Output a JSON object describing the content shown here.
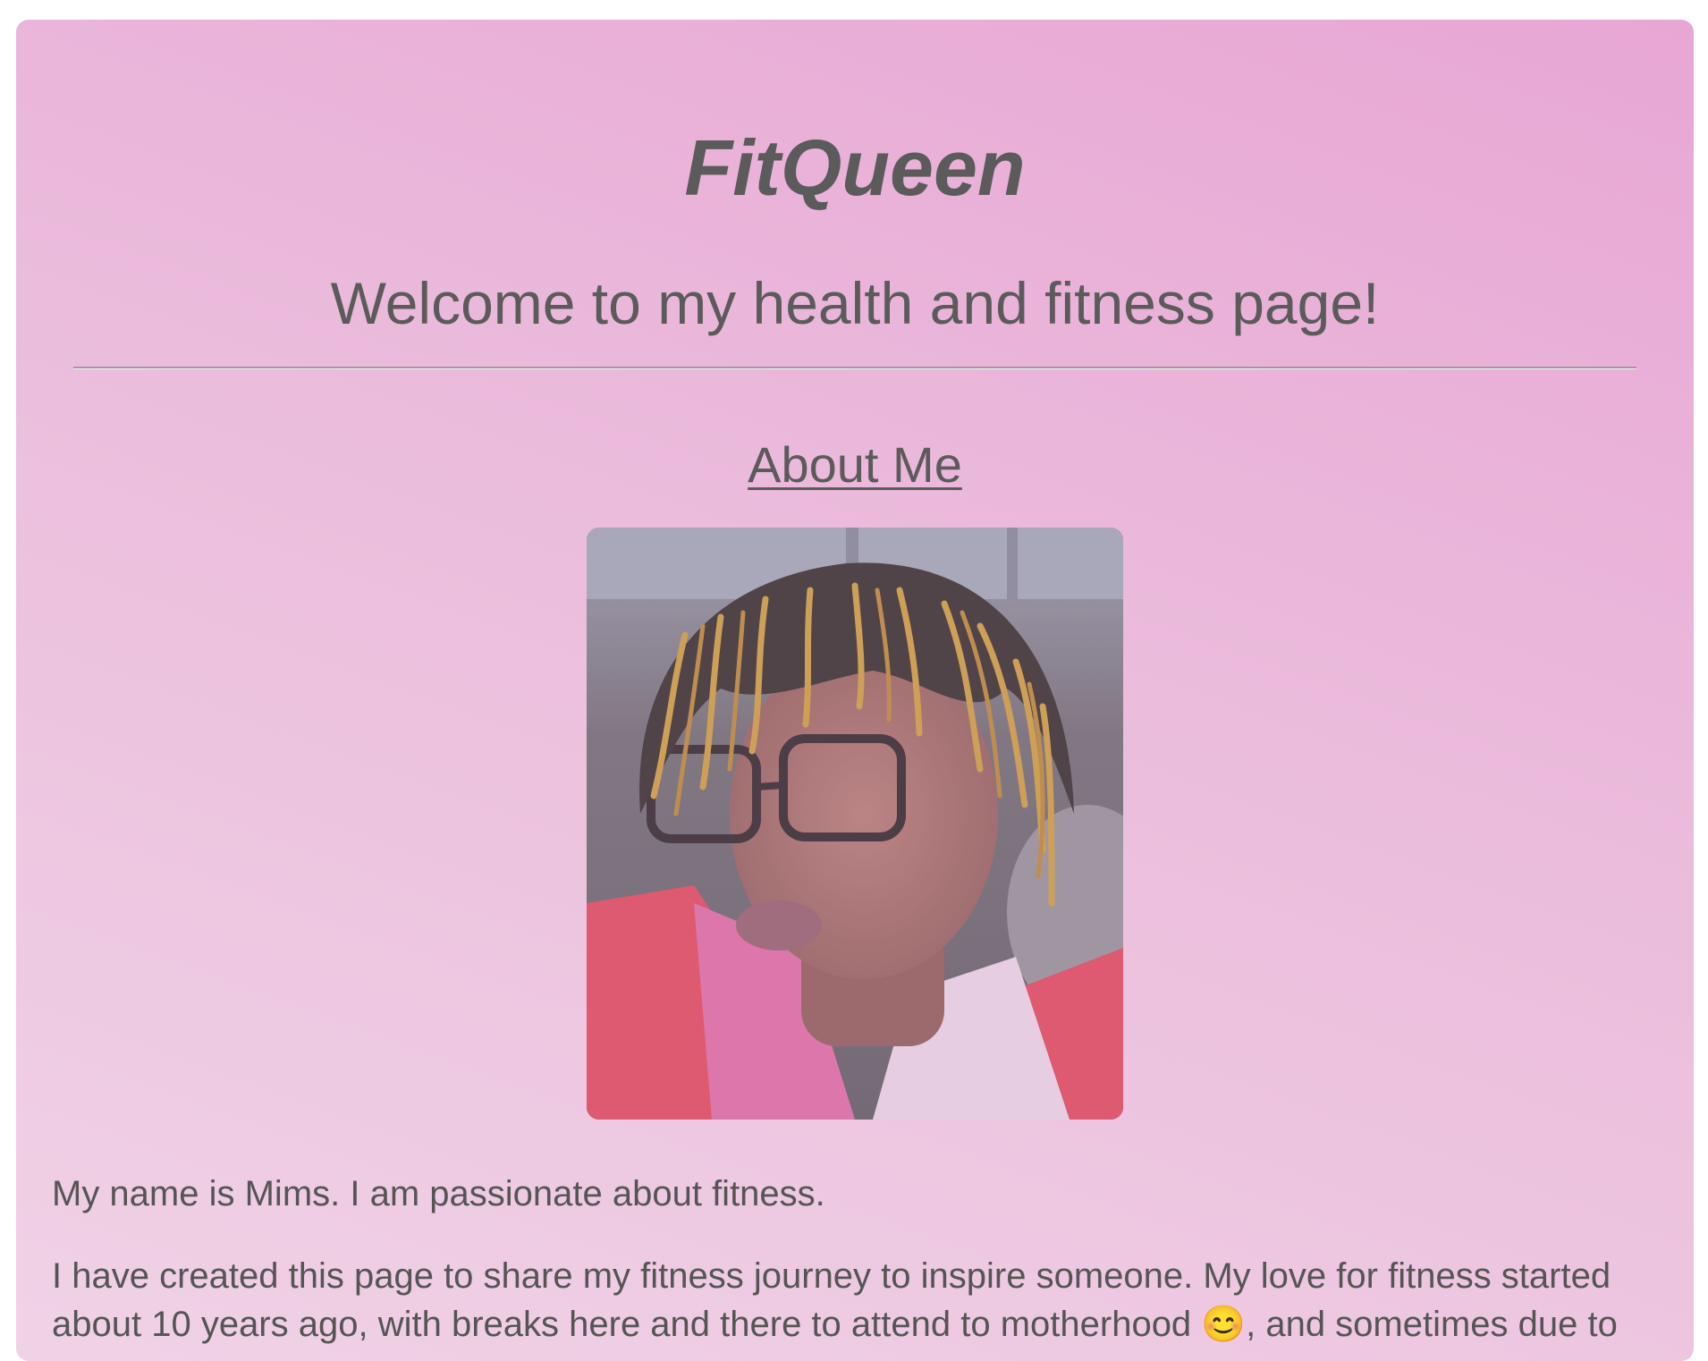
{
  "site": {
    "title": "FitQueen",
    "welcome": "Welcome to my health and fitness page!"
  },
  "about": {
    "heading": "About Me",
    "photo_alt": "Profile photo",
    "paragraphs": [
      "My name is Mims. I am passionate about fitness.",
      "I have created this page to share my fitness journey to inspire someone. My love for fitness started about 10 years ago, with breaks here and there to attend to motherhood 😊, and sometimes due to"
    ]
  },
  "colors": {
    "background_start": "#f0d2e6",
    "background_end": "#e8a6d5",
    "text": "#5b5b5b"
  }
}
